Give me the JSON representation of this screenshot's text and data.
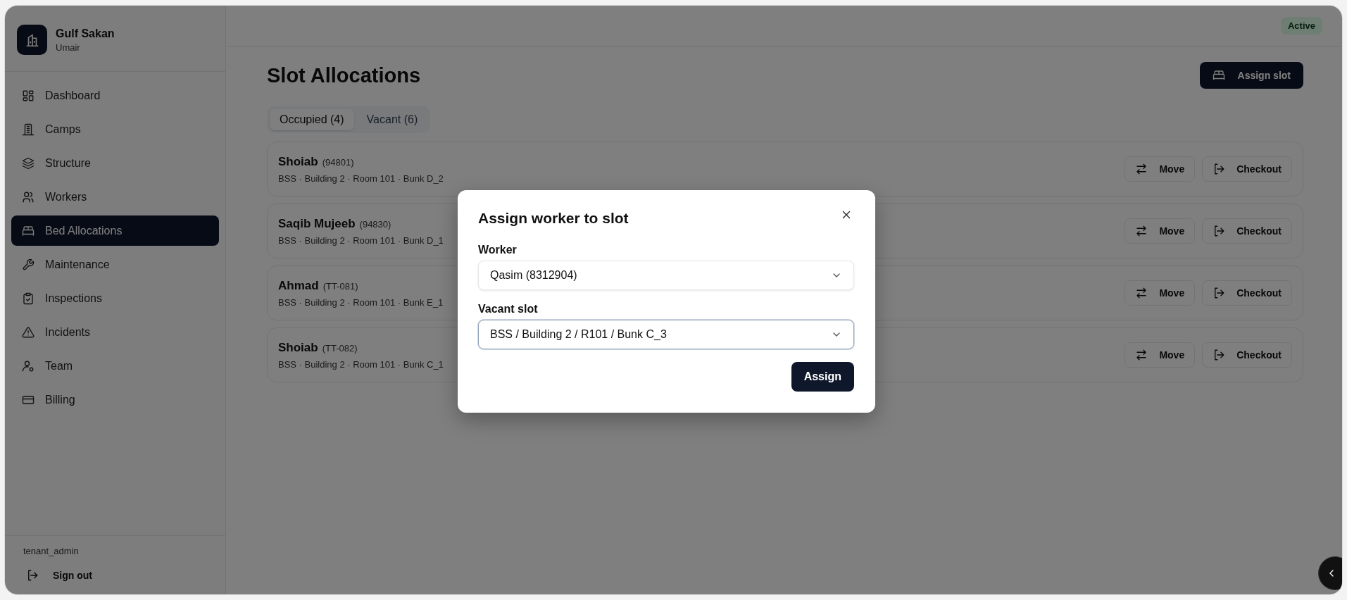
{
  "brand": {
    "name": "Gulf Sakan",
    "user": "Umair"
  },
  "nav": [
    {
      "label": "Dashboard",
      "selected": false
    },
    {
      "label": "Camps",
      "selected": false
    },
    {
      "label": "Structure",
      "selected": false
    },
    {
      "label": "Workers",
      "selected": false
    },
    {
      "label": "Bed Allocations",
      "selected": true
    },
    {
      "label": "Maintenance",
      "selected": false
    },
    {
      "label": "Inspections",
      "selected": false
    },
    {
      "label": "Incidents",
      "selected": false
    },
    {
      "label": "Team",
      "selected": false
    },
    {
      "label": "Billing",
      "selected": false
    }
  ],
  "sidebar_footer": {
    "role": "tenant_admin",
    "sign_out": "Sign out"
  },
  "header": {
    "status": "Active"
  },
  "page": {
    "title": "Slot Allocations",
    "assign_button": "Assign slot",
    "tabs": [
      {
        "label": "Occupied (4)",
        "selected": true
      },
      {
        "label": "Vacant (6)",
        "selected": false
      }
    ],
    "allocations": [
      {
        "name": "Shoiab",
        "code": "(94801)",
        "location": "BSS · Building 2 · Room 101 · Bunk D_2",
        "actions": [
          "Move",
          "Checkout"
        ]
      },
      {
        "name": "Saqib Mujeeb",
        "code": "(94830)",
        "location": "BSS · Building 2 · Room 101 · Bunk D_1",
        "actions": [
          "Move",
          "Checkout"
        ]
      },
      {
        "name": "Ahmad",
        "code": "(TT-081)",
        "location": "BSS · Building 2 · Room 101 · Bunk E_1",
        "actions": [
          "Move",
          "Checkout"
        ]
      },
      {
        "name": "Shoiab",
        "code": "(TT-082)",
        "location": "BSS · Building 2 · Room 101 · Bunk C_1",
        "actions": [
          "Move",
          "Checkout"
        ]
      }
    ]
  },
  "modal": {
    "title": "Assign worker to slot",
    "fields": [
      {
        "label": "Worker",
        "value": "Qasim (8312904)",
        "focused": false
      },
      {
        "label": "Vacant slot",
        "value": "BSS / Building 2 / R101 / Bunk C_3",
        "focused": true
      }
    ],
    "submit": "Assign"
  }
}
